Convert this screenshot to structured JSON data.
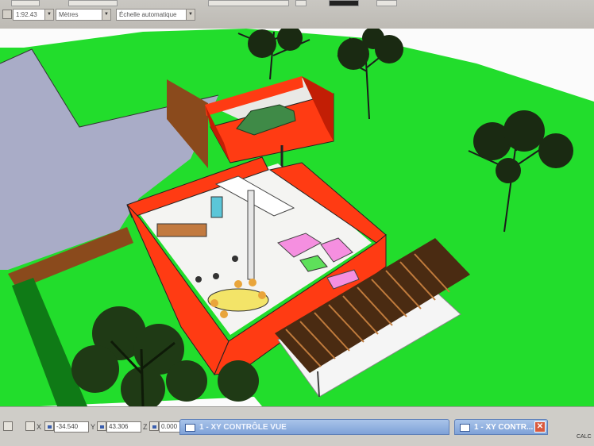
{
  "toolbar": {
    "scale_value": "1:92.43",
    "units_value": "Mètres",
    "scale_mode_value": "Échelle automatique"
  },
  "viewport": {
    "colors": {
      "lawn": "#22dd2c",
      "lawn_dark": "#14a81c",
      "road": "#a9acc7",
      "walls": "#ff3b13",
      "wall_shadow": "#c21e05",
      "floor": "#f4f4f2",
      "fence": "#8a4a1c",
      "sofa": "#f58fe0",
      "table": "#f3e468",
      "car": "#3f8a47",
      "pergola": "#4a2b12"
    }
  },
  "statusbar": {
    "x_label": "X",
    "x_value": "-34.540",
    "y_label": "Y",
    "y_value": "43.306",
    "z_label": "Z",
    "z_value": "0.000"
  },
  "panels": {
    "controls_title": "1 - XY CONTRÔLE VUE",
    "xy_title": "1 - XY CONTR...",
    "close_glyph": "✕"
  },
  "corner_text": "CALC"
}
